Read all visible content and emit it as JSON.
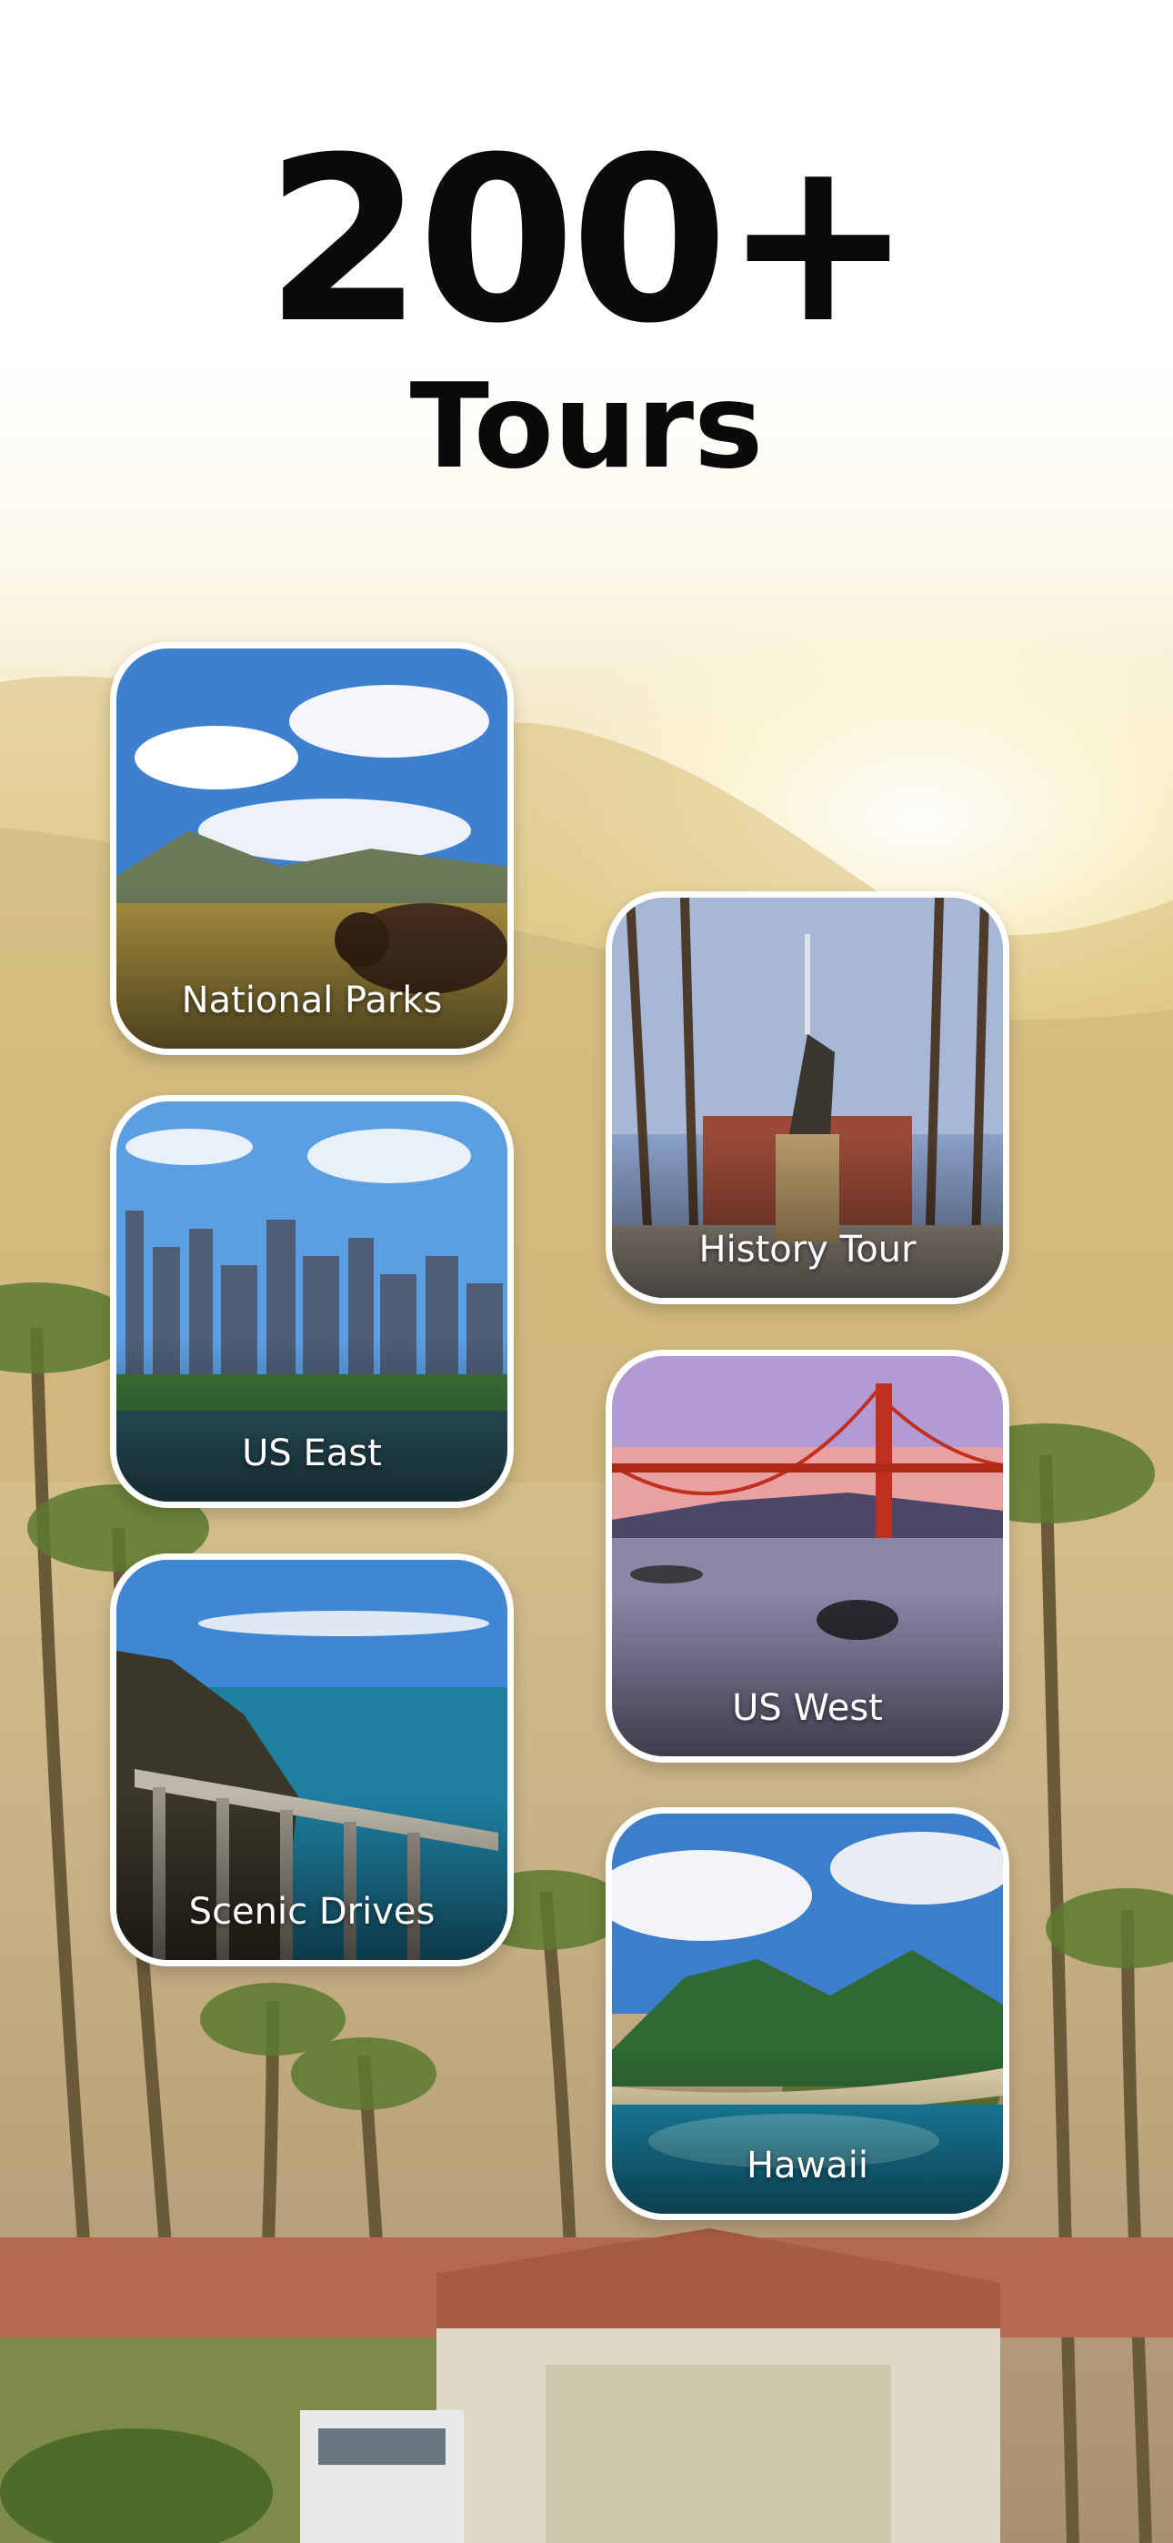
{
  "headline": {
    "count": "200+",
    "label": "Tours"
  },
  "tours": [
    {
      "label": "National Parks",
      "icon": "bison-landscape-image"
    },
    {
      "label": "History Tour",
      "icon": "statue-park-image"
    },
    {
      "label": "US East",
      "icon": "city-skyline-image"
    },
    {
      "label": "US West",
      "icon": "golden-gate-bridge-image"
    },
    {
      "label": "Scenic Drives",
      "icon": "coastal-bridge-image"
    },
    {
      "label": "Hawaii",
      "icon": "tropical-island-image"
    }
  ],
  "colors": {
    "card_border": "#ffffff",
    "headline": "#0a0a0a",
    "label": "#ffffff"
  }
}
